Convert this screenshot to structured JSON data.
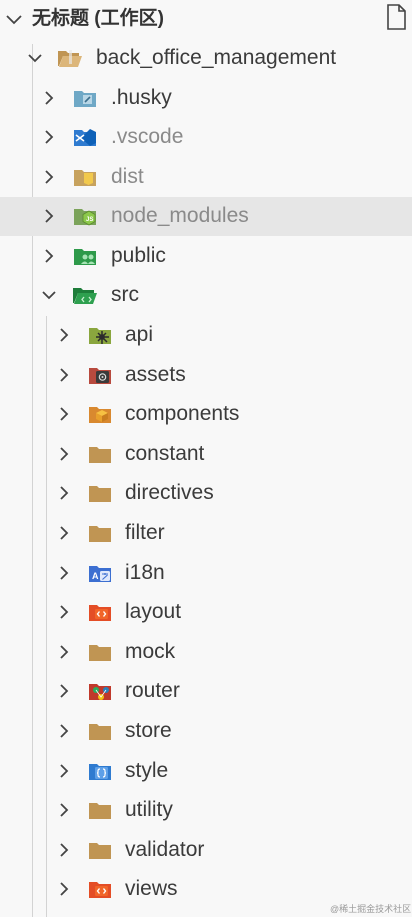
{
  "workspace": {
    "title": "无标题 (工作区)"
  },
  "tree": [
    {
      "label": "back_office_management",
      "expanded": true,
      "icon": "folder-open-icon"
    },
    {
      "label": ".husky",
      "expanded": false,
      "icon": "husky-folder-icon"
    },
    {
      "label": ".vscode",
      "expanded": false,
      "icon": "vscode-folder-icon",
      "dimmed": true
    },
    {
      "label": "dist",
      "expanded": false,
      "icon": "dist-folder-icon",
      "dimmed": true
    },
    {
      "label": "node_modules",
      "expanded": false,
      "icon": "node-modules-folder-icon",
      "dimmed": true,
      "hovered": true
    },
    {
      "label": "public",
      "expanded": false,
      "icon": "public-folder-icon"
    },
    {
      "label": "src",
      "expanded": true,
      "icon": "src-folder-icon"
    },
    {
      "label": "api",
      "expanded": false,
      "icon": "api-folder-icon"
    },
    {
      "label": "assets",
      "expanded": false,
      "icon": "assets-folder-icon"
    },
    {
      "label": "components",
      "expanded": false,
      "icon": "components-folder-icon"
    },
    {
      "label": "constant",
      "expanded": false,
      "icon": "folder-icon"
    },
    {
      "label": "directives",
      "expanded": false,
      "icon": "folder-icon"
    },
    {
      "label": "filter",
      "expanded": false,
      "icon": "folder-icon"
    },
    {
      "label": "i18n",
      "expanded": false,
      "icon": "i18n-folder-icon"
    },
    {
      "label": "layout",
      "expanded": false,
      "icon": "layout-folder-icon"
    },
    {
      "label": "mock",
      "expanded": false,
      "icon": "folder-icon"
    },
    {
      "label": "router",
      "expanded": false,
      "icon": "router-folder-icon"
    },
    {
      "label": "store",
      "expanded": false,
      "icon": "folder-icon"
    },
    {
      "label": "style",
      "expanded": false,
      "icon": "style-folder-icon"
    },
    {
      "label": "utility",
      "expanded": false,
      "icon": "folder-icon"
    },
    {
      "label": "validator",
      "expanded": false,
      "icon": "folder-icon"
    },
    {
      "label": "views",
      "expanded": false,
      "icon": "views-folder-icon"
    }
  ],
  "watermark": "@稀土掘金技术社区",
  "colors": {
    "folder": "#c09553",
    "hover_row": "#e6e6e6",
    "text": "#3b3b3b",
    "dimmed_text": "#8a8a8a"
  }
}
